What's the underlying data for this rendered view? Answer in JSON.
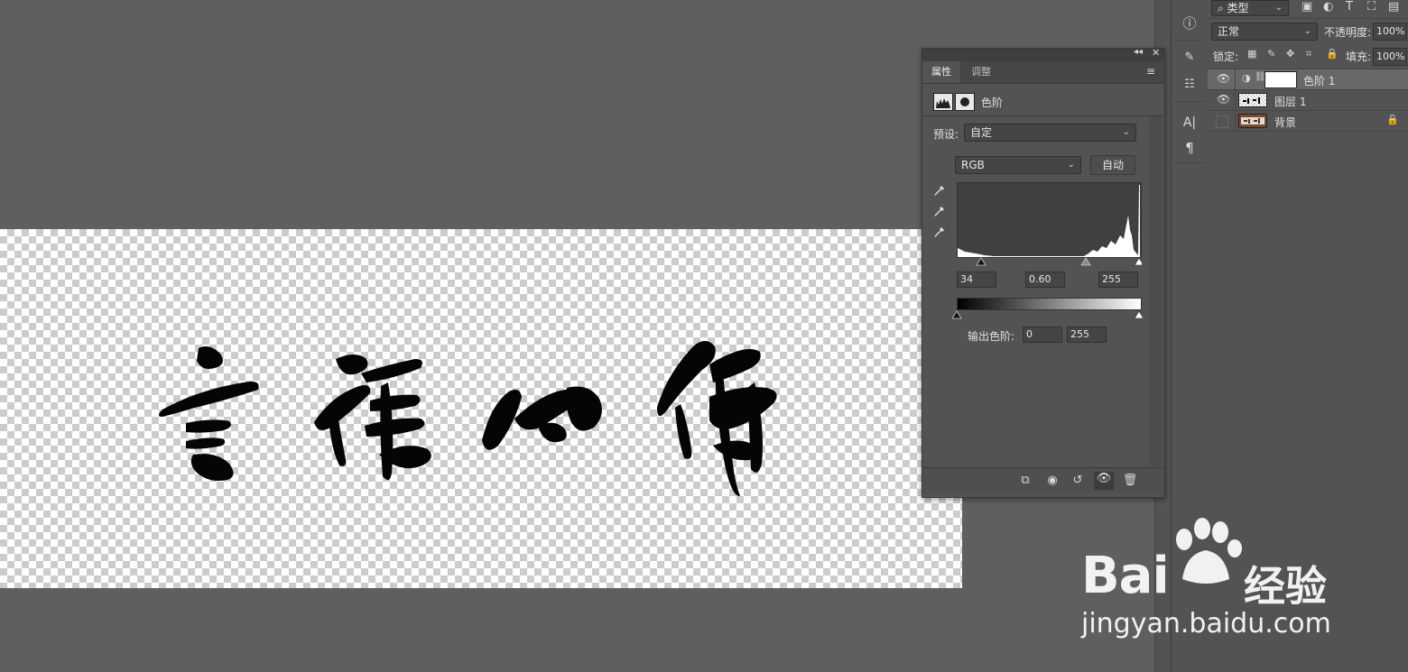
{
  "canvas": {
    "artwork_glyphs": [
      "言",
      "禅",
      "心",
      "佛"
    ]
  },
  "properties_panel": {
    "tabs": [
      {
        "label": "属性",
        "active": true
      },
      {
        "label": "调整",
        "active": false
      }
    ],
    "title": "色阶",
    "preset_label": "预设:",
    "preset_value": "自定",
    "channel_value": "RGB",
    "auto_button": "自动",
    "input_levels": {
      "black": "34",
      "gamma": "0.60",
      "white": "255"
    },
    "output_label": "输出色阶:",
    "output_levels": {
      "black": "0",
      "white": "255"
    }
  },
  "layers_panel": {
    "filter_kind": "类型",
    "blend_mode": "正常",
    "opacity_label": "不透明度:",
    "opacity_value": "100%",
    "lock_label": "锁定:",
    "fill_label": "填充:",
    "fill_value": "100%",
    "layers": [
      {
        "name": "色阶 1",
        "visible": true,
        "selected": true,
        "type": "adjustment"
      },
      {
        "name": "图层 1",
        "visible": true,
        "selected": false,
        "type": "pixel"
      },
      {
        "name": "背景",
        "visible": false,
        "selected": false,
        "type": "background",
        "locked": true
      }
    ]
  },
  "watermark": {
    "brand_left": "Bai",
    "brand_right": "经验",
    "url": "jingyan.baidu.com"
  },
  "colors": {
    "panel_bg": "#535353",
    "workspace_bg": "#5f5f5f",
    "selected_row": "#686868"
  }
}
